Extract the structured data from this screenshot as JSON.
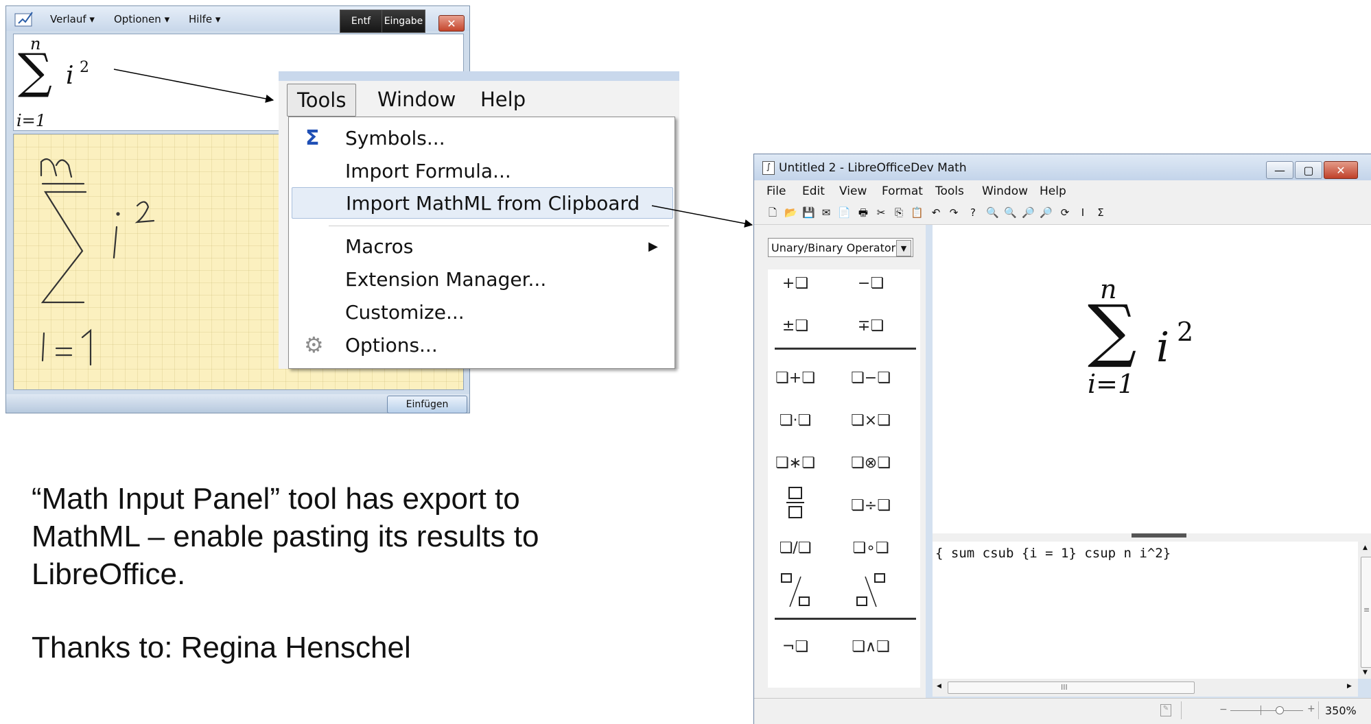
{
  "math_input_panel": {
    "menu": [
      "Verlauf ▾",
      "Optionen ▾",
      "Hilfe ▾"
    ],
    "delete_button": "Entf",
    "enter_button": "Eingabe",
    "close_symbol": "✕",
    "insert_button": "Einfügen",
    "preview": {
      "sum": "∑",
      "upper": "n",
      "lower": "i=1",
      "body": "i",
      "exp": "2"
    }
  },
  "tools_menu": {
    "menubar": [
      {
        "label": "Tools",
        "active": true
      },
      {
        "label": "Window",
        "active": false
      },
      {
        "label": "Help",
        "active": false
      }
    ],
    "items": [
      {
        "label": "Symbols...",
        "icon": "sigma-icon",
        "icon_glyph": "Σ",
        "highlighted": false,
        "submenu": false
      },
      {
        "label": "Import Formula...",
        "icon": "",
        "icon_glyph": "",
        "highlighted": false,
        "submenu": false
      },
      {
        "label": "Import MathML from Clipboard",
        "icon": "",
        "icon_glyph": "",
        "highlighted": true,
        "submenu": false
      },
      {
        "label": "Macros",
        "icon": "",
        "icon_glyph": "",
        "highlighted": false,
        "submenu": true
      },
      {
        "label": "Extension Manager...",
        "icon": "",
        "icon_glyph": "",
        "highlighted": false,
        "submenu": false
      },
      {
        "label": "Customize...",
        "icon": "",
        "icon_glyph": "",
        "highlighted": false,
        "submenu": false
      },
      {
        "label": "Options...",
        "icon": "gear-icon",
        "icon_glyph": "⚙",
        "highlighted": false,
        "submenu": false
      }
    ],
    "submenu_arrow": "▶"
  },
  "libreoffice": {
    "title": "Untitled 2 - LibreOfficeDev Math",
    "window_buttons": [
      "—",
      "▢",
      "✕"
    ],
    "menu": [
      "File",
      "Edit",
      "View",
      "Format",
      "Tools",
      "Window",
      "Help"
    ],
    "toolbar_icons": [
      {
        "name": "new-document-icon",
        "glyph": "🗋"
      },
      {
        "name": "open-folder-icon",
        "glyph": "📂"
      },
      {
        "name": "save-icon",
        "glyph": "💾"
      },
      {
        "name": "email-icon",
        "glyph": "✉"
      },
      {
        "name": "export-pdf-icon",
        "glyph": "📄"
      },
      {
        "name": "print-icon",
        "glyph": "🖶"
      },
      {
        "name": "cut-icon",
        "glyph": "✂"
      },
      {
        "name": "copy-icon",
        "glyph": "⎘"
      },
      {
        "name": "paste-icon",
        "glyph": "📋"
      },
      {
        "name": "undo-icon",
        "glyph": "↶"
      },
      {
        "name": "redo-icon",
        "glyph": "↷"
      },
      {
        "name": "help-icon",
        "glyph": "?"
      },
      {
        "name": "zoom-in-icon",
        "glyph": "🔍"
      },
      {
        "name": "zoom-out-icon",
        "glyph": "🔍"
      },
      {
        "name": "zoom-100-icon",
        "glyph": "🔎"
      },
      {
        "name": "show-all-icon",
        "glyph": "🔎"
      },
      {
        "name": "update-icon",
        "glyph": "⟳"
      },
      {
        "name": "formula-cursor-icon",
        "glyph": "I"
      },
      {
        "name": "symbols-icon",
        "glyph": "Σ"
      }
    ],
    "category_select": "Unary/Binary Operators",
    "elements": [
      "+❏",
      "−❏",
      "±❏",
      "∓❏",
      "❏+❏",
      "❏−❏",
      "❏·❏",
      "❏×❏",
      "❏∗❏",
      "❏⊗❏",
      "❏÷❏",
      "❏/❏",
      "❏∘❏",
      "¬❏",
      "❏∧❏"
    ],
    "formula": {
      "sum": "∑",
      "upper": "n",
      "lower": "i=1",
      "body": "i",
      "exp": "2"
    },
    "command": "{ sum csub {i = 1} csup n i^2}",
    "zoom": "350%",
    "scroll_glyphs": {
      "up": "▲",
      "down": "▼",
      "left": "◀",
      "right": "▶",
      "grip_h": "III",
      "grip_v": "≡"
    }
  },
  "caption": {
    "lines": [
      "“Math Input Panel” tool has export to",
      "MathML – enable pasting its results to",
      "LibreOffice."
    ],
    "thanks": "Thanks to: Regina Henschel"
  }
}
